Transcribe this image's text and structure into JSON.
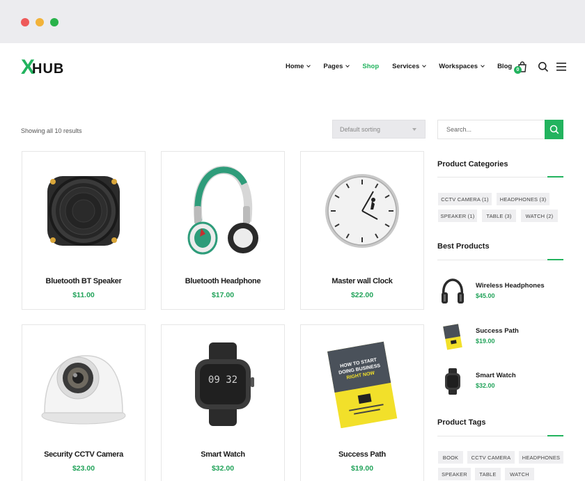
{
  "brand": {
    "logo_mark": "X",
    "logo_text": "HUB",
    "accent": "#22b35e"
  },
  "nav": {
    "items": [
      {
        "label": "Home",
        "dropdown": true,
        "active": false
      },
      {
        "label": "Pages",
        "dropdown": true,
        "active": false
      },
      {
        "label": "Shop",
        "dropdown": false,
        "active": true
      },
      {
        "label": "Services",
        "dropdown": true,
        "active": false
      },
      {
        "label": "Workspaces",
        "dropdown": true,
        "active": false
      },
      {
        "label": "Blog",
        "dropdown": false,
        "active": false
      }
    ],
    "cart_count": "0"
  },
  "shop": {
    "results_text": "Showing all 10 results",
    "sort_value": "Default sorting",
    "products": [
      {
        "name": "Bluetooth BT Speaker",
        "price": "$11.00",
        "icon": "speaker"
      },
      {
        "name": "Bluetooth Headphone",
        "price": "$17.00",
        "icon": "headphone"
      },
      {
        "name": "Master wall Clock",
        "price": "$22.00",
        "icon": "clock"
      },
      {
        "name": "Security CCTV Camera",
        "price": "$23.00",
        "icon": "cctv-camera"
      },
      {
        "name": "Smart Watch",
        "price": "$32.00",
        "icon": "smart-watch"
      },
      {
        "name": "Success Path",
        "price": "$19.00",
        "icon": "book"
      }
    ]
  },
  "sidebar": {
    "search_placeholder": "Search...",
    "categories_title": "Product Categories",
    "categories": [
      "CCTV CAMERA (1)",
      "HEADPHONES (3)",
      "SPEAKER (1)",
      "TABLE (3)",
      "WATCH (2)"
    ],
    "best_title": "Best Products",
    "best": [
      {
        "name": "Wireless Headphones",
        "price": "$45.00",
        "icon": "headphones"
      },
      {
        "name": "Success Path",
        "price": "$19.00",
        "icon": "book"
      },
      {
        "name": "Smart Watch",
        "price": "$32.00",
        "icon": "smart-watch"
      }
    ],
    "tags_title": "Product Tags",
    "tags": [
      "BOOK",
      "CCTV CAMERA",
      "HEADPHONES",
      "SPEAKER",
      "TABLE",
      "WATCH"
    ]
  },
  "book_cover_text": [
    "HOW TO START",
    "DOING BUSINESS",
    "RIGHT NOW"
  ],
  "watch_face_text": "09 32"
}
